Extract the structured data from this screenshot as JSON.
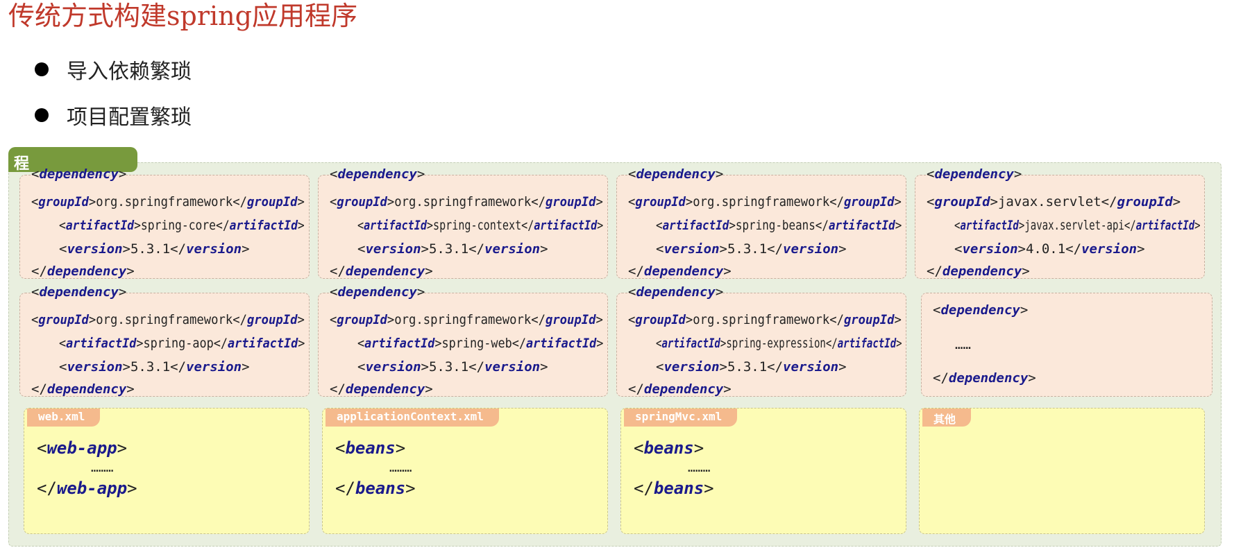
{
  "title": "传统方式构建spring应用程序",
  "bullets": [
    "导入依赖繁琐",
    "项目配置繁琐"
  ],
  "panel_tab_label": "程",
  "tag_names": {
    "dependency": "dependency",
    "groupId": "groupId",
    "artifactId": "artifactId",
    "version": "version"
  },
  "dependencies": [
    {
      "group": "org.springframework",
      "artifact": "spring-core",
      "version": "5.3.1"
    },
    {
      "group": "org.springframework",
      "artifact": "spring-context",
      "version": "5.3.1"
    },
    {
      "group": "org.springframework",
      "artifact": "spring-beans",
      "version": "5.3.1"
    },
    {
      "group": "javax.servlet",
      "artifact": "javax.servlet-api",
      "version": "4.0.1"
    },
    {
      "group": "org.springframework",
      "artifact": "spring-aop",
      "version": "5.3.1"
    },
    {
      "group": "org.springframework",
      "artifact": "spring-web",
      "version": "5.3.1"
    },
    {
      "group": "org.springframework",
      "artifact": "spring-expression",
      "version": "5.3.1"
    }
  ],
  "more_dependency": {
    "dots": "……"
  },
  "configs": [
    {
      "tab": "web.xml",
      "tag": "web-app",
      "dots": "………"
    },
    {
      "tab": "applicationContext.xml",
      "tag": "beans",
      "dots": "………"
    },
    {
      "tab": "springMvc.xml",
      "tag": "beans",
      "dots": "………"
    },
    {
      "tab": "其他",
      "tag": "",
      "dots": ""
    }
  ]
}
